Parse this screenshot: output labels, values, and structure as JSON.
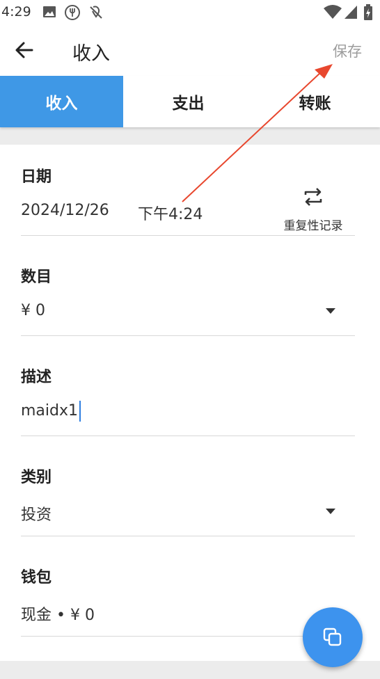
{
  "status_bar": {
    "time": "4:29",
    "left_icons": [
      "image-icon",
      "restaurant-icon",
      "no-location-icon"
    ],
    "right_icons": [
      "wifi-icon",
      "signal-icon",
      "battery-charging-icon"
    ]
  },
  "app_bar": {
    "title": "收入",
    "save_label": "保存"
  },
  "tabs": [
    {
      "label": "收入",
      "active": true
    },
    {
      "label": "支出",
      "active": false
    },
    {
      "label": "转账",
      "active": false
    }
  ],
  "form": {
    "date": {
      "label": "日期",
      "date_value": "2024/12/26",
      "time_value": "下午4:24",
      "repeat_label": "重复性记录"
    },
    "amount": {
      "label": "数目",
      "value": "¥ 0"
    },
    "description": {
      "label": "描述",
      "value": "maidx1"
    },
    "category": {
      "label": "类别",
      "value": "投资"
    },
    "wallet": {
      "label": "钱包",
      "value": "现金 • ¥ 0"
    }
  },
  "fab": {
    "icon": "copy-icon"
  },
  "colors": {
    "accent": "#3f98e6",
    "fab": "#3d93ee",
    "annotation_arrow": "#e8472e"
  }
}
